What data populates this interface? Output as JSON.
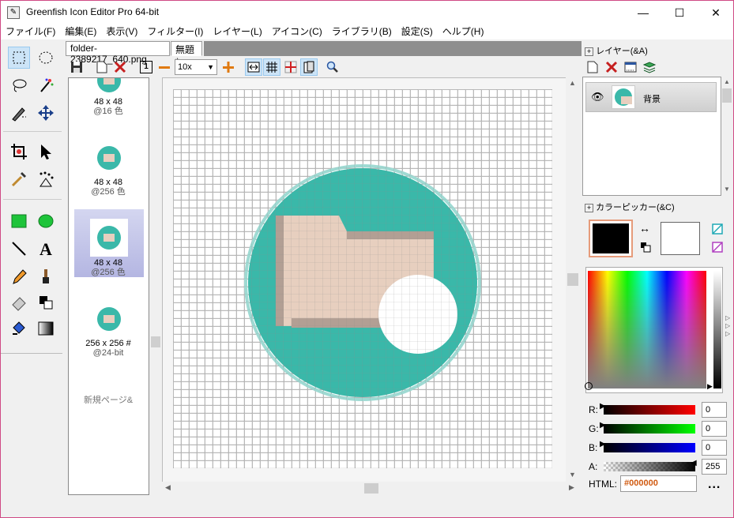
{
  "window": {
    "title": "Greenfish Icon Editor Pro 64-bit",
    "minimize": "—",
    "maximize": "☐",
    "close": "✕"
  },
  "menu": [
    "ファイル(F)",
    "編集(E)",
    "表示(V)",
    "フィルター(I)",
    "レイヤー(L)",
    "アイコン(C)",
    "ライブラリ(B)",
    "設定(S)",
    "ヘルプ(H)"
  ],
  "tabs": [
    {
      "label": "folder-2389217_640.png"
    },
    {
      "label": "無題*"
    }
  ],
  "toolbar": {
    "zoom": "10x",
    "page_number": "1"
  },
  "pages": [
    {
      "size": "48 x 48",
      "colors": "@16 色"
    },
    {
      "size": "48 x 48",
      "colors": "@256 色"
    },
    {
      "size": "48 x 48",
      "colors": "@256 色"
    },
    {
      "size": "256 x 256 #",
      "colors": "@24-bit"
    }
  ],
  "new_page": "新規ページ&",
  "layers": {
    "header": "レイヤー(&A)",
    "expander": "+",
    "items": [
      {
        "name": "背景"
      }
    ]
  },
  "color_picker": {
    "header": "カラーピッカー(&C)",
    "expander": "+",
    "primary": "#000000",
    "secondary": "#ffffff",
    "swap_glyph": "↔",
    "r_label": "R:",
    "r_value": "0",
    "g_label": "G:",
    "g_value": "0",
    "b_label": "B:",
    "b_value": "0",
    "a_label": "A:",
    "a_value": "255",
    "html_label": "HTML:",
    "html_value": "#000000",
    "more": "..."
  },
  "colors": {
    "teal": "#3ab8a9",
    "teal_light": "#9fdad3",
    "folder": "#e7cfbf",
    "folder_dark": "#b29f94",
    "accent_title": "#d04a84"
  }
}
